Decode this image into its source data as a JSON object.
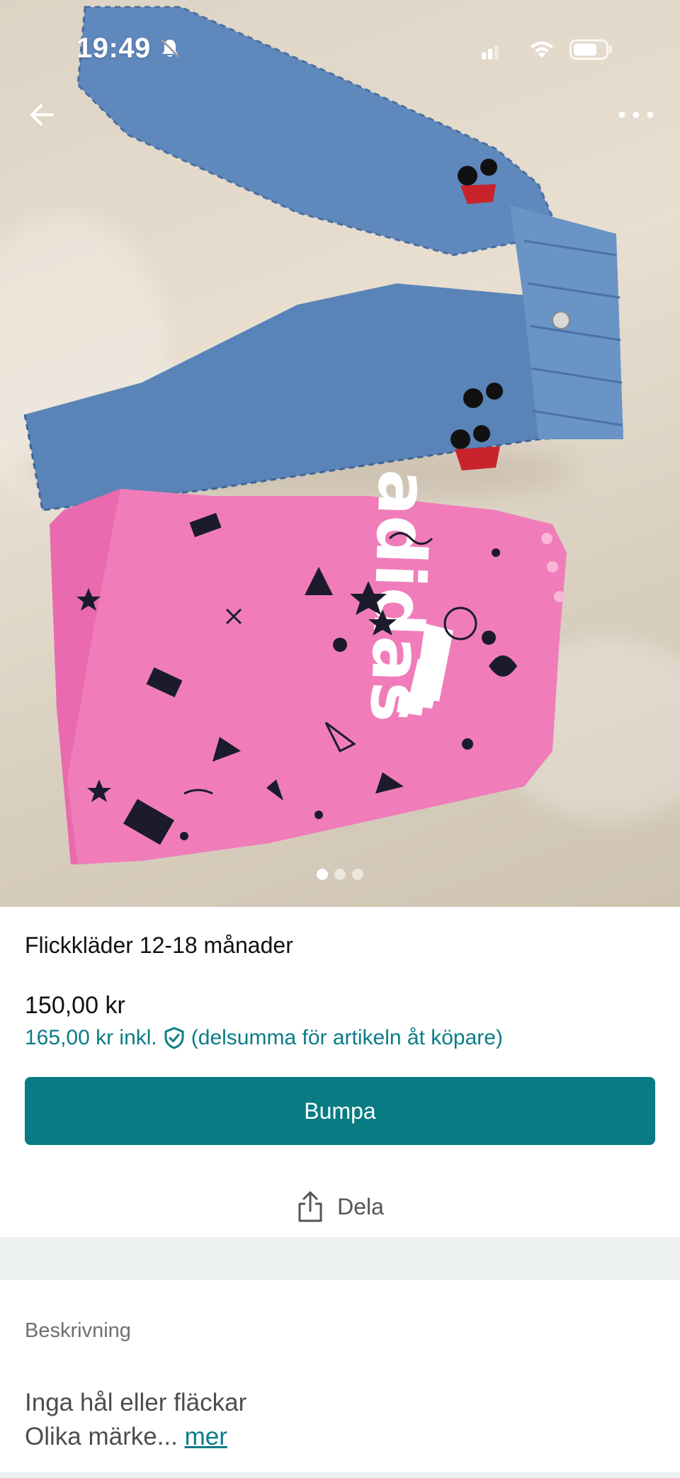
{
  "status_bar": {
    "time": "19:49"
  },
  "navigation": {
    "back_icon": "arrow-left-icon",
    "more_icon": "more-horizontal-icon"
  },
  "gallery": {
    "image_count": 3,
    "active_index": 0
  },
  "listing": {
    "title": "Flickkläder 12-18 månader",
    "price": "150,00 kr",
    "price_incl": "165,00 kr inkl.",
    "price_incl_note": "(delsumma för artikeln åt köpare)",
    "protection_icon": "shield-check-icon"
  },
  "actions": {
    "bump_label": "Bumpa",
    "share_label": "Dela",
    "share_icon": "share-icon"
  },
  "description": {
    "heading": "Beskrivning",
    "line1": "Inga hål eller fläckar",
    "line2": "Olika märke...",
    "more_label": "mer"
  },
  "colors": {
    "accent": "#087b83",
    "link": "#0a7c87",
    "divider": "#edf0f1"
  }
}
